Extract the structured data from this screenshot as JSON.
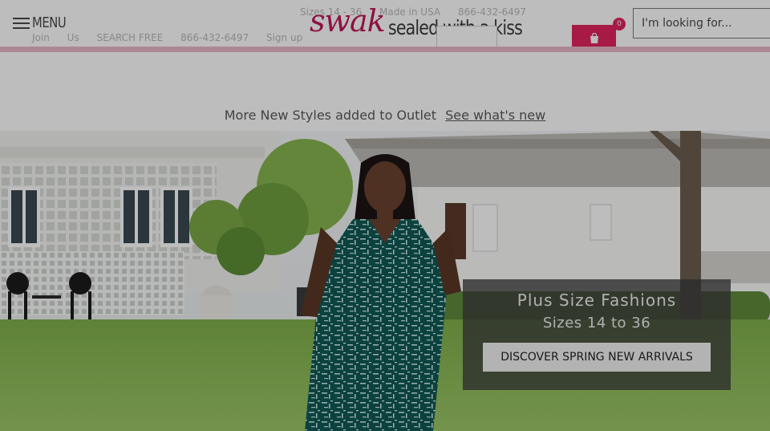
{
  "header": {
    "menu_label": "MENU",
    "logo_script": "swak",
    "logo_tagline": "sealed with a kiss",
    "top_links": [
      "Sizes 14 - 36",
      "Made in USA",
      "866-432-6497"
    ],
    "sub_links": [
      "Join",
      "Us",
      "SEARCH FREE",
      "866-432-6497",
      "Sign up"
    ],
    "cart_count": "0",
    "search_placeholder": "I'm looking for..."
  },
  "announcement": {
    "text": "More New Styles added to Outlet",
    "link": "See what's new"
  },
  "hero": {
    "title": "Plus Size Fashions",
    "subtitle": "Sizes 14 to 36",
    "cta": "DISCOVER SPRING NEW ARRIVALS"
  },
  "colors": {
    "brand_pink": "#e0245e",
    "logo_pink": "#c2185b",
    "dress_teal": "#0f5a56"
  }
}
